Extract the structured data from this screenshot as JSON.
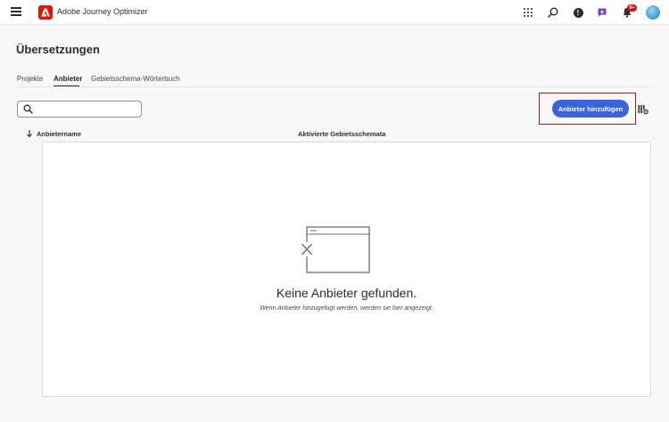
{
  "header": {
    "app_title": "Adobe Journey Optimizer",
    "notification_count": "9+",
    "icons": [
      "menu-icon",
      "adobe-logo-icon",
      "apps-grid-icon",
      "search-icon",
      "help-icon",
      "gift-icon",
      "bell-icon",
      "user-avatar"
    ]
  },
  "page": {
    "title": "Übersetzungen"
  },
  "tabs": [
    {
      "label": "Projekte",
      "active": false
    },
    {
      "label": "Anbieter",
      "active": true
    },
    {
      "label": "Gebietsschema-Wörterbuch",
      "active": false
    }
  ],
  "toolbar": {
    "search_value": "",
    "add_button_label": "Anbieter hinzufügen"
  },
  "table": {
    "columns": [
      "Anbietername",
      "Aktivierte Gebietsschemata"
    ],
    "rows": []
  },
  "empty_state": {
    "title": "Keine Anbieter gefunden.",
    "subtitle": "Wenn Anbieter hinzugefugt werden, werden sie hier angezeigt."
  },
  "colors": {
    "accent": "#3b63e0",
    "brand": "#eb1000",
    "highlight": "#a41c26",
    "badge": "#d31510"
  }
}
